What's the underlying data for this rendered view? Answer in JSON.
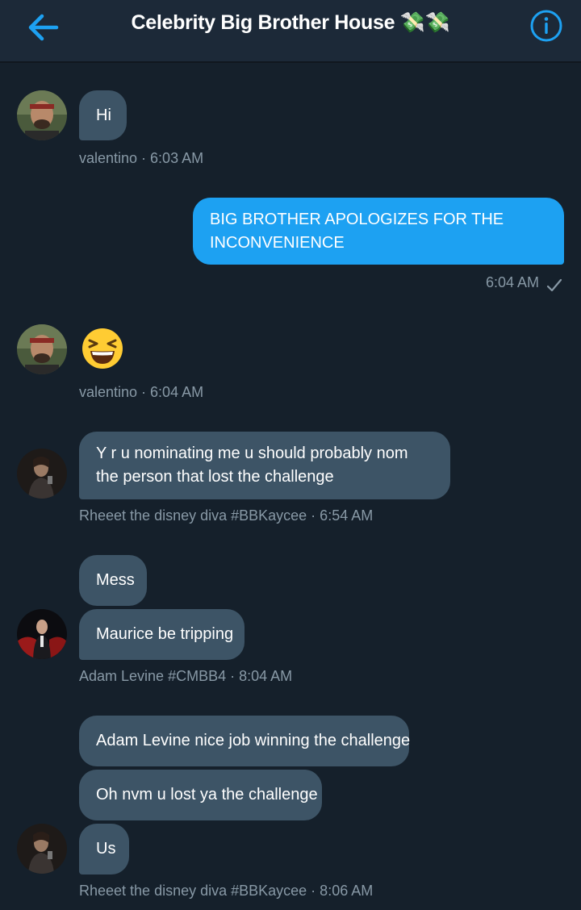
{
  "header": {
    "back_icon": "arrow-left-icon",
    "title": "Celebrity Big Brother House 💸💸",
    "info_icon": "info-icon",
    "accent_color": "#1da1f2"
  },
  "messages": {
    "m1": {
      "text": "Hi",
      "meta": "valentino · 6:03 AM"
    },
    "m2": {
      "text": "BIG BROTHER APOLOGIZES FOR THE INCONVENIENCE",
      "meta": "6:04 AM",
      "status_icon": "checkmark-icon"
    },
    "m3": {
      "emoji": "laughing-squint-emoji",
      "meta": "valentino · 6:04 AM"
    },
    "m4": {
      "text": "Y r u nominating me u should probably nom the person that lost the challenge",
      "meta": "Rheeet the disney diva #BBKaycee · 6:54 AM"
    },
    "m5": {
      "text": "Mess"
    },
    "m6": {
      "text": "Maurice be tripping",
      "meta": "Adam Levine #CMBB4 · 8:04 AM"
    },
    "m7": {
      "text": "Adam Levine nice job winning the challenge"
    },
    "m8": {
      "text": "Oh nvm u lost ya the challenge"
    },
    "m9": {
      "text": "Us",
      "meta": "Rheeet the disney diva #BBKaycee · 8:06 AM"
    }
  },
  "colors": {
    "background": "#15202b",
    "header": "#1c2938",
    "incoming_bubble": "#3d5466",
    "outgoing_bubble": "#1da1f2",
    "meta_text": "#8899a6"
  }
}
